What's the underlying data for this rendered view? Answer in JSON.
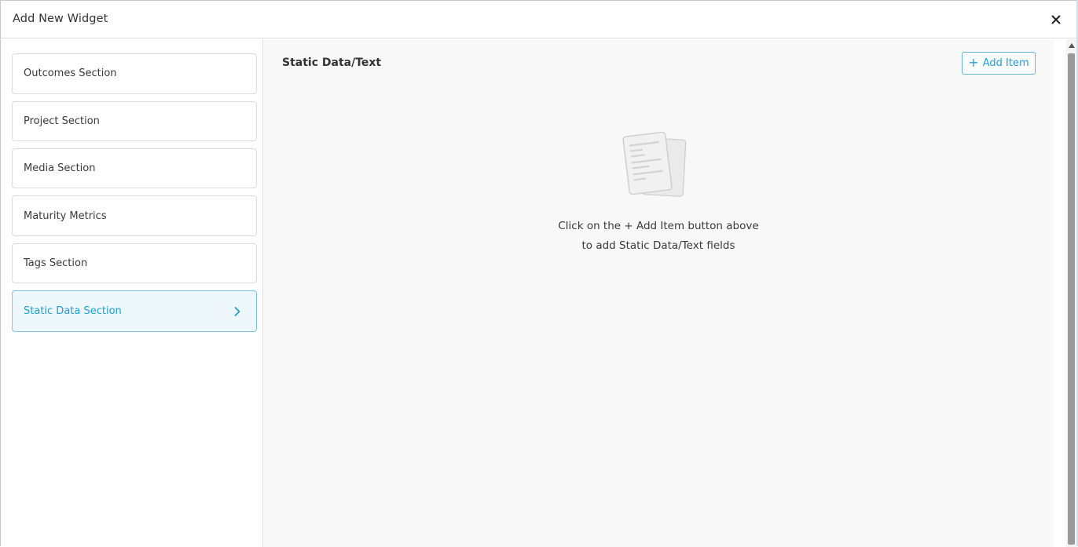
{
  "modal": {
    "title": "Add New Widget",
    "close_icon": "close-icon"
  },
  "sidebar": {
    "items": [
      {
        "label": "Outcomes Section",
        "active": false
      },
      {
        "label": "Project Section",
        "active": false
      },
      {
        "label": "Media Section",
        "active": false
      },
      {
        "label": "Maturity Metrics",
        "active": false
      },
      {
        "label": "Tags Section",
        "active": false
      },
      {
        "label": "Static Data Section",
        "active": true,
        "icon": "chevron-right-icon"
      }
    ]
  },
  "main": {
    "title": "Static Data/Text",
    "add_button": {
      "icon": "plus-icon",
      "label": "Add Item"
    },
    "empty_state": {
      "icon": "document-icon",
      "line1": "Click on the + Add Item button above",
      "line2": "to add Static Data/Text fields"
    }
  },
  "colors": {
    "accent": "#1e9fd6",
    "active_bg": "#eef8fc",
    "content_bg": "#f8f8f8"
  }
}
